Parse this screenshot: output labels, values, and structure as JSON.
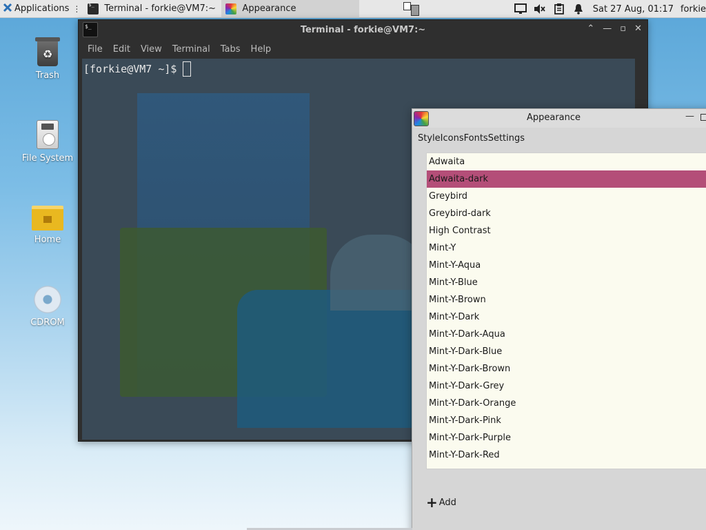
{
  "panel": {
    "applications_label": "Applications",
    "tasks": [
      {
        "label": "Terminal - forkie@VM7:~",
        "icon": "terminal-icon"
      },
      {
        "label": "Appearance",
        "icon": "appearance-icon"
      }
    ],
    "clock": "Sat 27 Aug, 01:17",
    "user": "forkie"
  },
  "desktop": {
    "icons": [
      {
        "label": "Trash",
        "icon": "trash-icon"
      },
      {
        "label": "File System",
        "icon": "filesystem-icon"
      },
      {
        "label": "Home",
        "icon": "home-folder-icon"
      },
      {
        "label": "CDROM",
        "icon": "cdrom-icon"
      }
    ]
  },
  "terminal": {
    "title": "Terminal - forkie@VM7:~",
    "menu": [
      "File",
      "Edit",
      "View",
      "Terminal",
      "Tabs",
      "Help"
    ],
    "prompt": "[forkie@VM7 ~]$"
  },
  "appearance": {
    "title": "Appearance",
    "tabs": [
      "Style",
      "Icons",
      "Fonts",
      "Settings"
    ],
    "themes": [
      "Adwaita",
      "Adwaita-dark",
      "Greybird",
      "Greybird-dark",
      "High Contrast",
      "Mint-Y",
      "Mint-Y-Aqua",
      "Mint-Y-Blue",
      "Mint-Y-Brown",
      "Mint-Y-Dark",
      "Mint-Y-Dark-Aqua",
      "Mint-Y-Dark-Blue",
      "Mint-Y-Dark-Brown",
      "Mint-Y-Dark-Grey",
      "Mint-Y-Dark-Orange",
      "Mint-Y-Dark-Pink",
      "Mint-Y-Dark-Purple",
      "Mint-Y-Dark-Red"
    ],
    "selected_theme": "Adwaita-dark",
    "add_label": "Add"
  },
  "colors": {
    "selection": "#b44e78",
    "list_bg": "#fbfbef",
    "terminal_bg": "#2f2f2f"
  }
}
